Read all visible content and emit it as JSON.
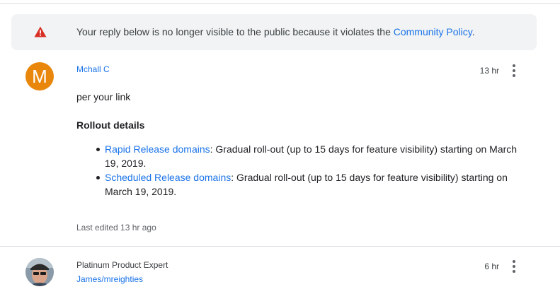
{
  "notice": {
    "icon": "warning-icon",
    "text_before": "Your reply below is no longer visible to the public because it violates the ",
    "link_text": "Community Policy",
    "text_after": ".",
    "icon_color": "#d93025"
  },
  "reply1": {
    "avatar_letter": "M",
    "avatar_color": "#e8870c",
    "author": "Mchall C",
    "time": "13 hr",
    "intro": "per your link",
    "heading": "Rollout details",
    "items": [
      {
        "link": "Rapid Release domains",
        "text": ": Gradual roll-out (up to 15 days for feature visibility) starting on March 19, 2019."
      },
      {
        "link": "Scheduled Release domains",
        "text": ": Gradual roll-out (up to 15 days for feature visibility) starting on March 19, 2019."
      }
    ],
    "edited": "Last edited 13 hr ago"
  },
  "reply2": {
    "role": "Platinum Product Expert",
    "author": "James/mreighties",
    "time": "6 hr"
  },
  "colors": {
    "link": "#1a73e8",
    "notice_bg": "#f1f3f4",
    "divider": "#dadce0"
  }
}
